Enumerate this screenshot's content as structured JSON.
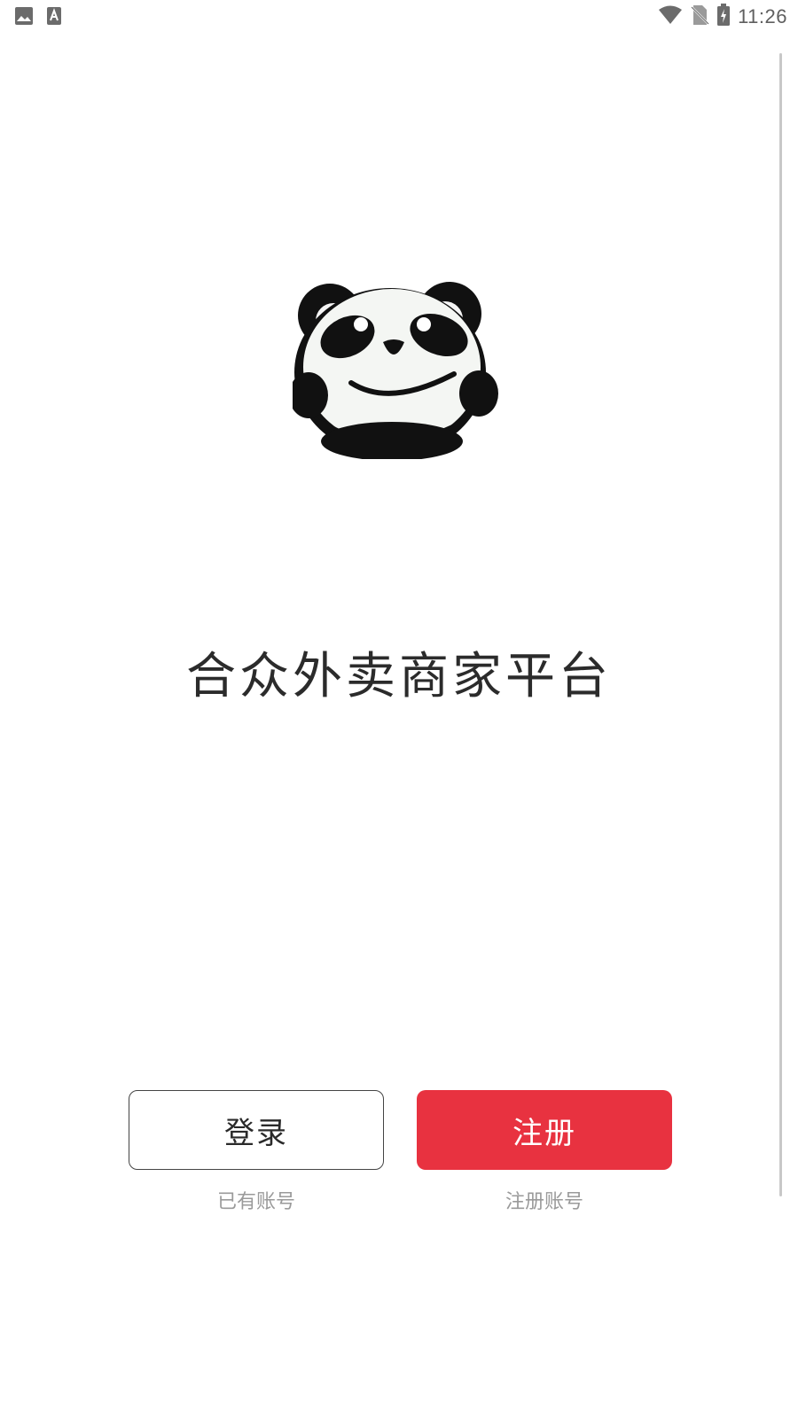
{
  "status_bar": {
    "time": "11:26",
    "left_icons": [
      "image-icon",
      "font-icon"
    ],
    "right_icons": [
      "wifi-icon",
      "no-sim-icon",
      "battery-charging-icon"
    ]
  },
  "logo": {
    "name": "panda-logo-icon"
  },
  "title": "合众外卖商家平台",
  "login": {
    "label": "登录",
    "hint": "已有账号"
  },
  "register": {
    "label": "注册",
    "hint": "注册账号",
    "color": "#e83240"
  }
}
